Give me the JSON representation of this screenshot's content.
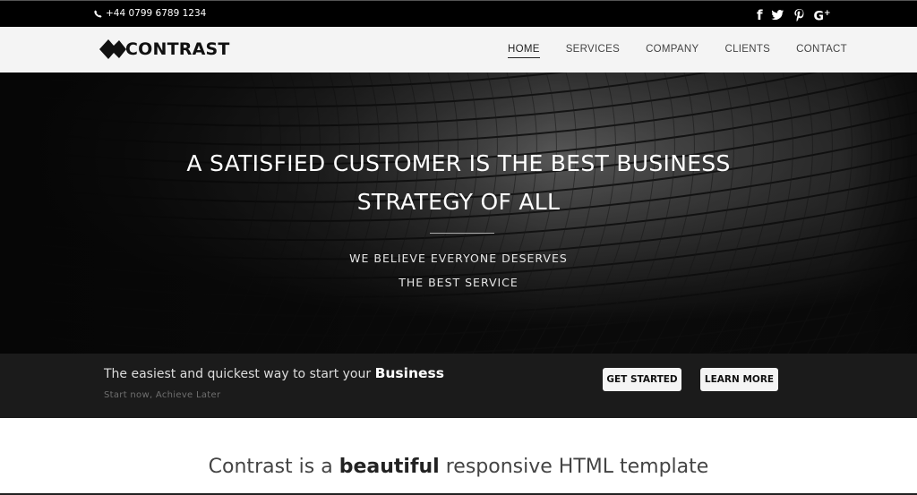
{
  "topbar": {
    "phone_icon": "phone-icon",
    "phone": "+44 0799 6789 1234",
    "social": [
      {
        "name": "facebook-icon",
        "glyph": "f"
      },
      {
        "name": "twitter-icon",
        "glyph": "twitter"
      },
      {
        "name": "pinterest-icon",
        "glyph": "P"
      },
      {
        "name": "google-plus-icon",
        "glyph": "G+"
      }
    ]
  },
  "navbar": {
    "logo_text": "CONTRAST",
    "logo_icon": "diamond-logo-icon",
    "items": [
      {
        "label": "HOME",
        "active": true
      },
      {
        "label": "SERVICES",
        "active": false
      },
      {
        "label": "COMPANY",
        "active": false
      },
      {
        "label": "CLIENTS",
        "active": false
      },
      {
        "label": "CONTACT",
        "active": false
      }
    ]
  },
  "hero": {
    "title_line1": "A SATISFIED CUSTOMER IS THE BEST BUSINESS",
    "title_line2": "STRATEGY OF ALL",
    "subtitle_line1": "WE BELIEVE EVERYONE DESERVES",
    "subtitle_line2": "THE BEST SERVICE"
  },
  "cta": {
    "lead_text": "The easiest and quickest way to start your",
    "lead_emphasis": "Business",
    "tagline": "Start now, Achieve Later",
    "get_started_label": "GET STARTED",
    "learn_more_label": "LEARN MORE"
  },
  "intro": {
    "heading_pre": "Contrast is a",
    "heading_bold": "beautiful",
    "heading_post": "responsive HTML template"
  },
  "colors": {
    "topbar_bg": "#000000",
    "navbar_bg": "#f4f4f4",
    "cta_bg": "#1b1b1b",
    "button_bg": "#f4f4f4"
  }
}
